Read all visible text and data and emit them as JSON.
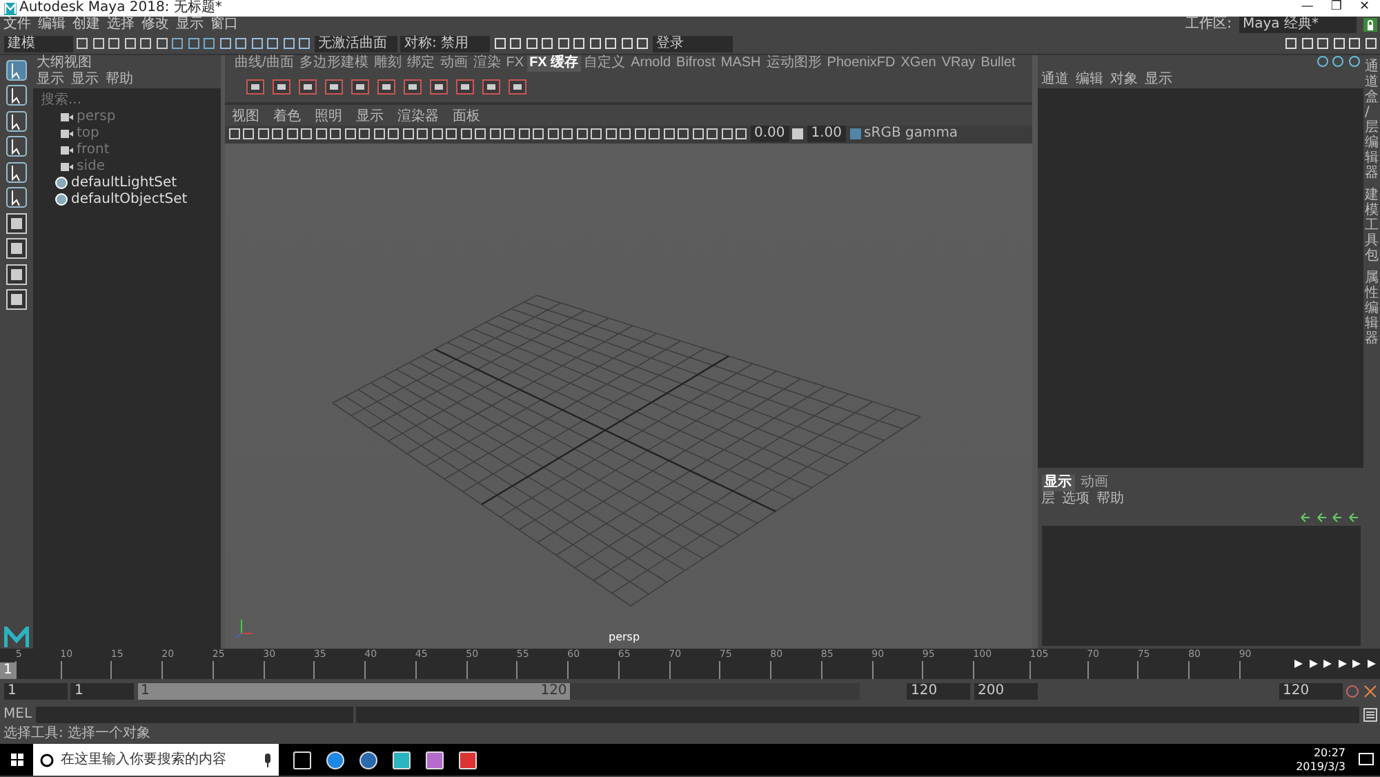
{
  "window": {
    "title": "Autodesk Maya 2018: 无标题*",
    "controls": [
      "—",
      "❐",
      "✕"
    ]
  },
  "menu": [
    "文件",
    "编辑",
    "创建",
    "选择",
    "修改",
    "显示",
    "窗口"
  ],
  "workspace": {
    "label": "工作区:",
    "value": "Maya 经典*"
  },
  "status_line": {
    "mode": "建模",
    "surface": "无激活曲面",
    "symmetry": "对称: 禁用",
    "login": "登录"
  },
  "shelf": {
    "tabs": [
      {
        "label": "曲线/曲面",
        "selected": false
      },
      {
        "label": "多边形建模",
        "selected": false
      },
      {
        "label": "雕刻",
        "selected": false
      },
      {
        "label": "绑定",
        "selected": false
      },
      {
        "label": "动画",
        "selected": false
      },
      {
        "label": "渲染",
        "selected": false
      },
      {
        "label": "FX",
        "selected": false
      },
      {
        "label": "FX 缓存",
        "selected": true
      },
      {
        "label": "自定义",
        "selected": false
      },
      {
        "label": "Arnold",
        "selected": false
      },
      {
        "label": "Bifrost",
        "selected": false
      },
      {
        "label": "MASH",
        "selected": false
      },
      {
        "label": "运动图形",
        "selected": false
      },
      {
        "label": "PhoenixFD",
        "selected": false
      },
      {
        "label": "XGen",
        "selected": false
      },
      {
        "label": "VRay",
        "selected": false
      },
      {
        "label": "Bullet",
        "selected": false
      }
    ]
  },
  "outliner": {
    "title": "大纲视图",
    "menu": [
      "显示",
      "显示",
      "帮助"
    ],
    "placeholder": "搜索...",
    "items": [
      {
        "label": "persp",
        "kind": "camera",
        "dimmed": true
      },
      {
        "label": "top",
        "kind": "camera",
        "dimmed": true
      },
      {
        "label": "front",
        "kind": "camera",
        "dimmed": true
      },
      {
        "label": "side",
        "kind": "camera",
        "dimmed": true
      },
      {
        "label": "defaultLightSet",
        "kind": "set",
        "dimmed": false
      },
      {
        "label": "defaultObjectSet",
        "kind": "set",
        "dimmed": false
      }
    ]
  },
  "viewport": {
    "menu": [
      "视图",
      "着色",
      "照明",
      "显示",
      "渲染器",
      "面板"
    ],
    "exposure": "0.00",
    "gamma": "1.00",
    "color_space": "sRGB gamma",
    "camera_label": "persp"
  },
  "channel_box": {
    "menu": [
      "通道",
      "编辑",
      "对象",
      "显示"
    ]
  },
  "layer_editor": {
    "tabs": [
      {
        "label": "显示",
        "selected": true
      },
      {
        "label": "动画",
        "selected": false
      }
    ],
    "menu": [
      "层",
      "选项",
      "帮助"
    ]
  },
  "side_tabs": [
    "通道盒/层编辑器",
    "建模工具包",
    "属性编辑器"
  ],
  "timeline": {
    "current": "1",
    "ticks": [
      "5",
      "10",
      "15",
      "20",
      "25",
      "30",
      "35",
      "40",
      "45",
      "50",
      "55",
      "60",
      "65",
      "70",
      "75",
      "80",
      "85",
      "90",
      "95",
      "100",
      "105",
      "70",
      "75",
      "80",
      "90"
    ]
  },
  "range": {
    "start": "1",
    "playback_start": "1",
    "slider_start": "1",
    "slider_end": "120",
    "playback_end": "120",
    "end": "200",
    "current_frame": "120",
    "level": 0.6
  },
  "command_line": {
    "label": "MEL"
  },
  "help_line": "选择工具: 选择一个对象",
  "taskbar": {
    "placeholder": "在这里输入你要搜索的内容",
    "time": "20:27",
    "date": "2019/3/3"
  }
}
